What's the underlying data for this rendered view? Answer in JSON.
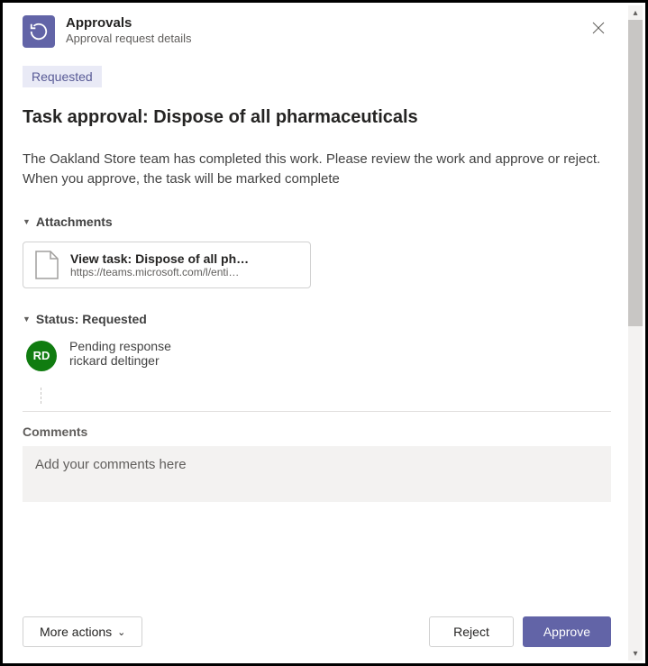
{
  "header": {
    "app_title": "Approvals",
    "app_subtitle": "Approval request details"
  },
  "status_badge": "Requested",
  "main_title": "Task approval: Dispose of all pharmaceuticals",
  "description": "The Oakland Store team has completed this work. Please review the work and approve or reject. When you approve, the task will be marked complete",
  "sections": {
    "attachments_label": "Attachments",
    "status_label": "Status: Requested",
    "comments_label": "Comments"
  },
  "attachment": {
    "title": "View task: Dispose of all ph…",
    "url": "https://teams.microsoft.com/l/enti…"
  },
  "approver": {
    "initials": "RD",
    "status_line": "Pending response",
    "name": "rickard deltinger"
  },
  "comments": {
    "placeholder": "Add your comments here"
  },
  "footer": {
    "more_actions": "More actions",
    "reject": "Reject",
    "approve": "Approve"
  }
}
